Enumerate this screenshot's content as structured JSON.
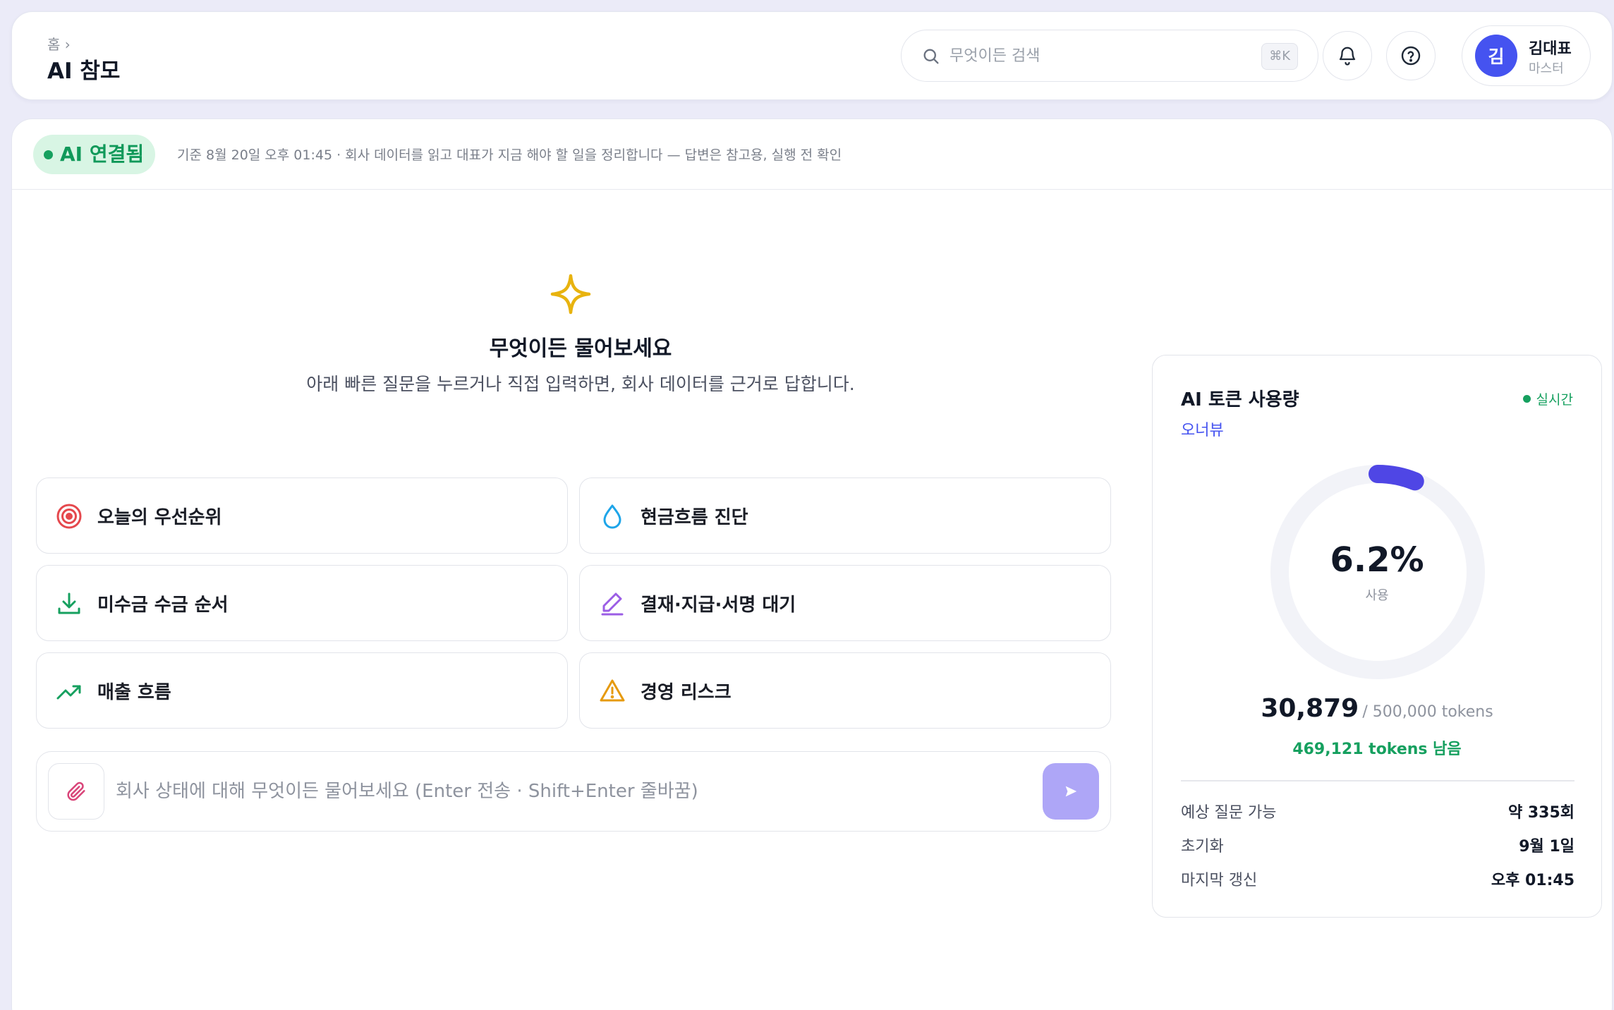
{
  "header": {
    "breadcrumb": "홈 ›",
    "title": "AI 참모",
    "search": {
      "placeholder": "무엇이든 검색",
      "shortcut": "⌘K",
      "icon": "search-icon"
    },
    "icons": [
      "bell-icon",
      "help-icon"
    ],
    "user": {
      "avatar_initial": "김",
      "name": "김대표",
      "role": "마스터",
      "avatar_color": "#4553f0"
    }
  },
  "status": {
    "badge": "AI 연결됨",
    "text": "기준 8월 20일 오후 01:45 · 회사 데이터를 읽고 대표가 지금 해야 할 일을 정리합니다 — 답변은 참고용, 실행 전 확인",
    "badge_color": "#10995a"
  },
  "hero": {
    "icon": "sparkle-icon",
    "title": "무엇이든 물어보세요",
    "subtitle": "아래 빠른 질문을 누르거나 직접 입력하면, 회사 데이터를 근거로 답합니다."
  },
  "quick_questions": [
    {
      "label": "오늘의 우선순위",
      "icon": "target-icon",
      "color": "#e5484d"
    },
    {
      "label": "현금흐름 진단",
      "icon": "droplet-icon",
      "color": "#1ea5e9"
    },
    {
      "label": "미수금 수금 순서",
      "icon": "download-icon",
      "color": "#16a05f"
    },
    {
      "label": "결재·지급·서명 대기",
      "icon": "pen-icon",
      "color": "#9b5de5"
    },
    {
      "label": "매출 흐름",
      "icon": "trending-up-icon",
      "color": "#16a05f"
    },
    {
      "label": "경영 리스크",
      "icon": "warning-icon",
      "color": "#e69a0e"
    }
  ],
  "composer": {
    "placeholder": "회사 상태에 대해 무엇이든 물어보세요 (Enter 전송 · Shift+Enter 줄바꿈)",
    "attach_icon": "paperclip-icon",
    "send_icon": "send-icon"
  },
  "usage_panel": {
    "title": "AI 토큰 사용량",
    "live": "실시간",
    "plan": "오너뷰",
    "percent_text": "6.2%",
    "percent_value": 6.2,
    "percent_label": "사용",
    "used": "30,879",
    "total": "/ 500,000 tokens",
    "remaining": "469,121 tokens 남음",
    "stats": [
      {
        "label": "예상 질문 가능",
        "value": "약 335회"
      },
      {
        "label": "초기화",
        "value": "9월 1일"
      },
      {
        "label": "마지막 갱신",
        "value": "오후 01:45"
      }
    ],
    "accent": "#4f46e5"
  }
}
